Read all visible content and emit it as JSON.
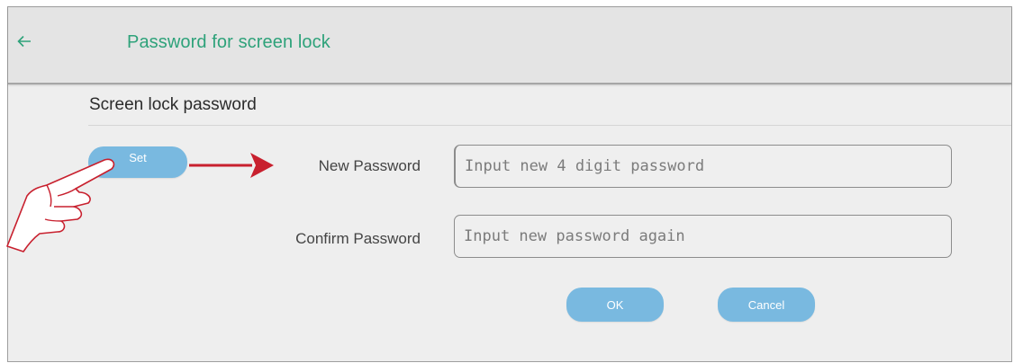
{
  "header": {
    "back_icon": "arrow-left-icon",
    "title": "Password for screen lock"
  },
  "section": {
    "title": "Screen lock password"
  },
  "set_button": {
    "label": "Set"
  },
  "fields": {
    "new_password": {
      "label": "New Password",
      "placeholder": "Input new 4 digit password",
      "value": ""
    },
    "confirm_password": {
      "label": "Confirm Password",
      "placeholder": "Input new password again",
      "value": ""
    }
  },
  "buttons": {
    "ok_label": "OK",
    "cancel_label": "Cancel"
  },
  "annotations": {
    "pointer_arrow_icon": "red-arrow-right-icon",
    "hand_icon": "pointing-hand-icon"
  },
  "colors": {
    "title_green": "#2ea27a",
    "button_blue": "#79b9e0",
    "arrow_red": "#c8202e"
  }
}
